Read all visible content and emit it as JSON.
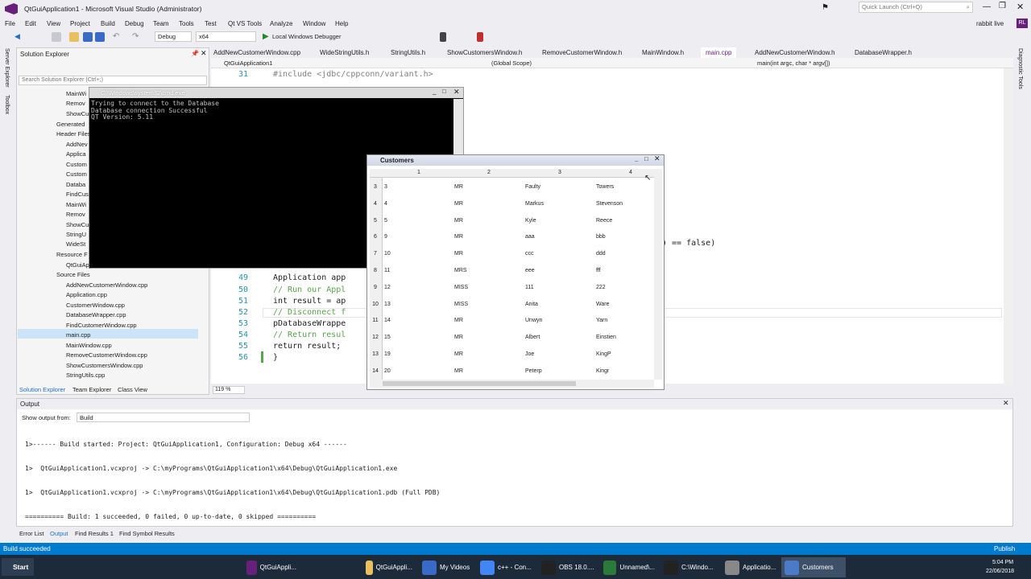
{
  "window": {
    "title": "QtGuiApplication1 - Microsoft Visual Studio (Administrator)",
    "quick_launch": "Quick Launch (Ctrl+Q)",
    "user": "rabbit live",
    "user_initials": "RL"
  },
  "menu": [
    "File",
    "Edit",
    "View",
    "Project",
    "Build",
    "Debug",
    "Team",
    "Tools",
    "Test",
    "Qt VS Tools",
    "Analyze",
    "Window",
    "Help"
  ],
  "toolbar": {
    "config": "Debug",
    "platform": "x64",
    "run": "Local Windows Debugger"
  },
  "solution_explorer": {
    "title": "Solution Explorer",
    "search": "Search Solution Explorer (Ctrl+;)",
    "items": [
      "MainWi",
      "Remov",
      "ShowCu",
      "Generated",
      "Header Files",
      "AddNev",
      "Applica",
      "Custom",
      "Custom",
      "Databa",
      "FindCus",
      "MainWi",
      "Remov",
      "ShowCu",
      "StringU",
      "WideSt",
      "Resource F",
      "QtGuiApp",
      "Source Files",
      "AddNewCustomerWindow.cpp",
      "Application.cpp",
      "CustomerWindow.cpp",
      "DatabaseWrapper.cpp",
      "FindCustomerWindow.cpp",
      "main.cpp",
      "MainWindow.cpp",
      "RemoveCustomerWindow.cpp",
      "ShowCustomersWindow.cpp",
      "StringUtils.cpp"
    ],
    "tabs": [
      "Solution Explorer",
      "Team Explorer",
      "Class View"
    ]
  },
  "side_tabs": [
    "Server Explorer",
    "Toolbox"
  ],
  "right_tab": "Diagnostic Tools",
  "doc_tabs": [
    "AddNewCustomerWindow.cpp",
    "WideStringUtils.h",
    "StringUtils.h",
    "ShowCustomersWindow.h",
    "RemoveCustomerWindow.h",
    "MainWindow.h",
    "main.cpp",
    "AddNewCustomerWindow.h",
    "DatabaseWrapper.h"
  ],
  "nav": {
    "project": "QtGuiApplication1",
    "scope": "(Global Scope)",
    "func": "main(int argc, char * argv[])"
  },
  "code_lines": [
    {
      "n": "31",
      "t": "#include <jdbc/cppconn/variant.h>"
    },
    {
      "n": "49",
      "t": "Application app"
    },
    {
      "n": "50",
      "t": "// Run our Appl"
    },
    {
      "n": "51",
      "t": "int result = ap"
    },
    {
      "n": "52",
      "t": "// Disconnect f"
    },
    {
      "n": "53",
      "t": "pDatabaseWrappe"
    },
    {
      "n": "54",
      "t": "// Return resul"
    },
    {
      "n": "55",
      "t": "return result;"
    },
    {
      "n": "56",
      "t": "}"
    }
  ],
  "code_fragment": ") == false)",
  "zoom": "119 %",
  "cmd": {
    "title": "C:\\Windows\\system32\\cmd.exe",
    "lines": [
      "Trying to connect to the Database",
      "Database connection Successful",
      "QT Version: 5.11"
    ]
  },
  "customers": {
    "title": "Customers",
    "headers": [
      "1",
      "2",
      "3",
      "4"
    ],
    "rows": [
      [
        "3",
        "3",
        "MR",
        "Faulty",
        "Towers"
      ],
      [
        "4",
        "4",
        "MR",
        "Markus",
        "Stevenson"
      ],
      [
        "5",
        "5",
        "MR",
        "Kyle",
        "Reece"
      ],
      [
        "6",
        "9",
        "MR",
        "aaa",
        "bbb"
      ],
      [
        "7",
        "10",
        "MR",
        "ccc",
        "ddd"
      ],
      [
        "8",
        "11",
        "MRS",
        "eee",
        "fff"
      ],
      [
        "9",
        "12",
        "MISS",
        "111",
        "222"
      ],
      [
        "10",
        "13",
        "MISS",
        "Anita",
        "Ware"
      ],
      [
        "11",
        "14",
        "MR",
        "Unwyn",
        "Yarn"
      ],
      [
        "12",
        "15",
        "MR",
        "Albert",
        "Einstien"
      ],
      [
        "13",
        "19",
        "MR",
        "Joe",
        "KingP"
      ],
      [
        "14",
        "20",
        "MR",
        "Peterp",
        "Kingr"
      ]
    ]
  },
  "output": {
    "title": "Output",
    "show_label": "Show output from:",
    "source": "Build",
    "lines": [
      "1>------ Build started: Project: QtGuiApplication1, Configuration: Debug x64 ------",
      "1>  QtGuiApplication1.vcxproj -> C:\\myPrograms\\QtGuiApplication1\\x64\\Debug\\QtGuiApplication1.exe",
      "1>  QtGuiApplication1.vcxproj -> C:\\myPrograms\\QtGuiApplication1\\x64\\Debug\\QtGuiApplication1.pdb (Full PDB)",
      "========== Build: 1 succeeded, 0 failed, 0 up-to-date, 0 skipped =========="
    ],
    "tabs": [
      "Error List",
      "Output",
      "Find Results 1",
      "Find Symbol Results"
    ]
  },
  "status": {
    "text": "Build succeeded",
    "publish": "Publish"
  },
  "taskbar": {
    "start": "Start",
    "items": [
      "QtGuiAppli...",
      "QtGuiAppli...",
      "My Videos",
      "c++ - Con...",
      "OBS 18.0....",
      "Unnamed\\...",
      "C:\\Windo...",
      "Applicatio...",
      "Customers"
    ],
    "time": "5:04 PM",
    "date": "22/06/2018"
  }
}
